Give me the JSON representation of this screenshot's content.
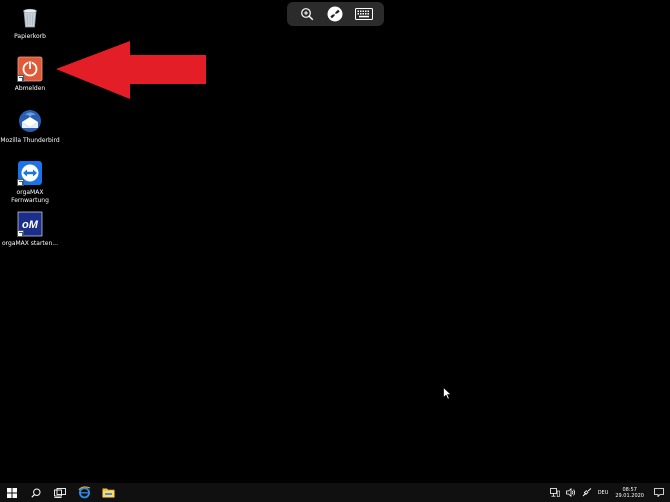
{
  "desktop": {
    "icons": [
      {
        "label": "Papierkorb",
        "icon": "recycle-bin-icon"
      },
      {
        "label": "Abmelden",
        "icon": "power-icon"
      },
      {
        "label": "Mozilla Thunderbird",
        "icon": "thunderbird-icon"
      },
      {
        "label": "orgaMAX\nFernwartung",
        "icon": "teamviewer-icon"
      },
      {
        "label": "orgaMAX starten...",
        "icon": "orgamax-icon",
        "logo_text": "oM"
      }
    ]
  },
  "remote_toolbar": {
    "buttons": [
      "zoom-icon",
      "disconnect-icon",
      "keyboard-icon"
    ]
  },
  "annotation": {
    "arrow_color": "#e41e26"
  },
  "taskbar": {
    "language": "DEU",
    "time": "08:57",
    "date": "29.01.2020"
  },
  "colors": {
    "desktop_bg": "#000000",
    "taskbar_bg": "#101010",
    "accent_blue": "#1a73e8"
  }
}
